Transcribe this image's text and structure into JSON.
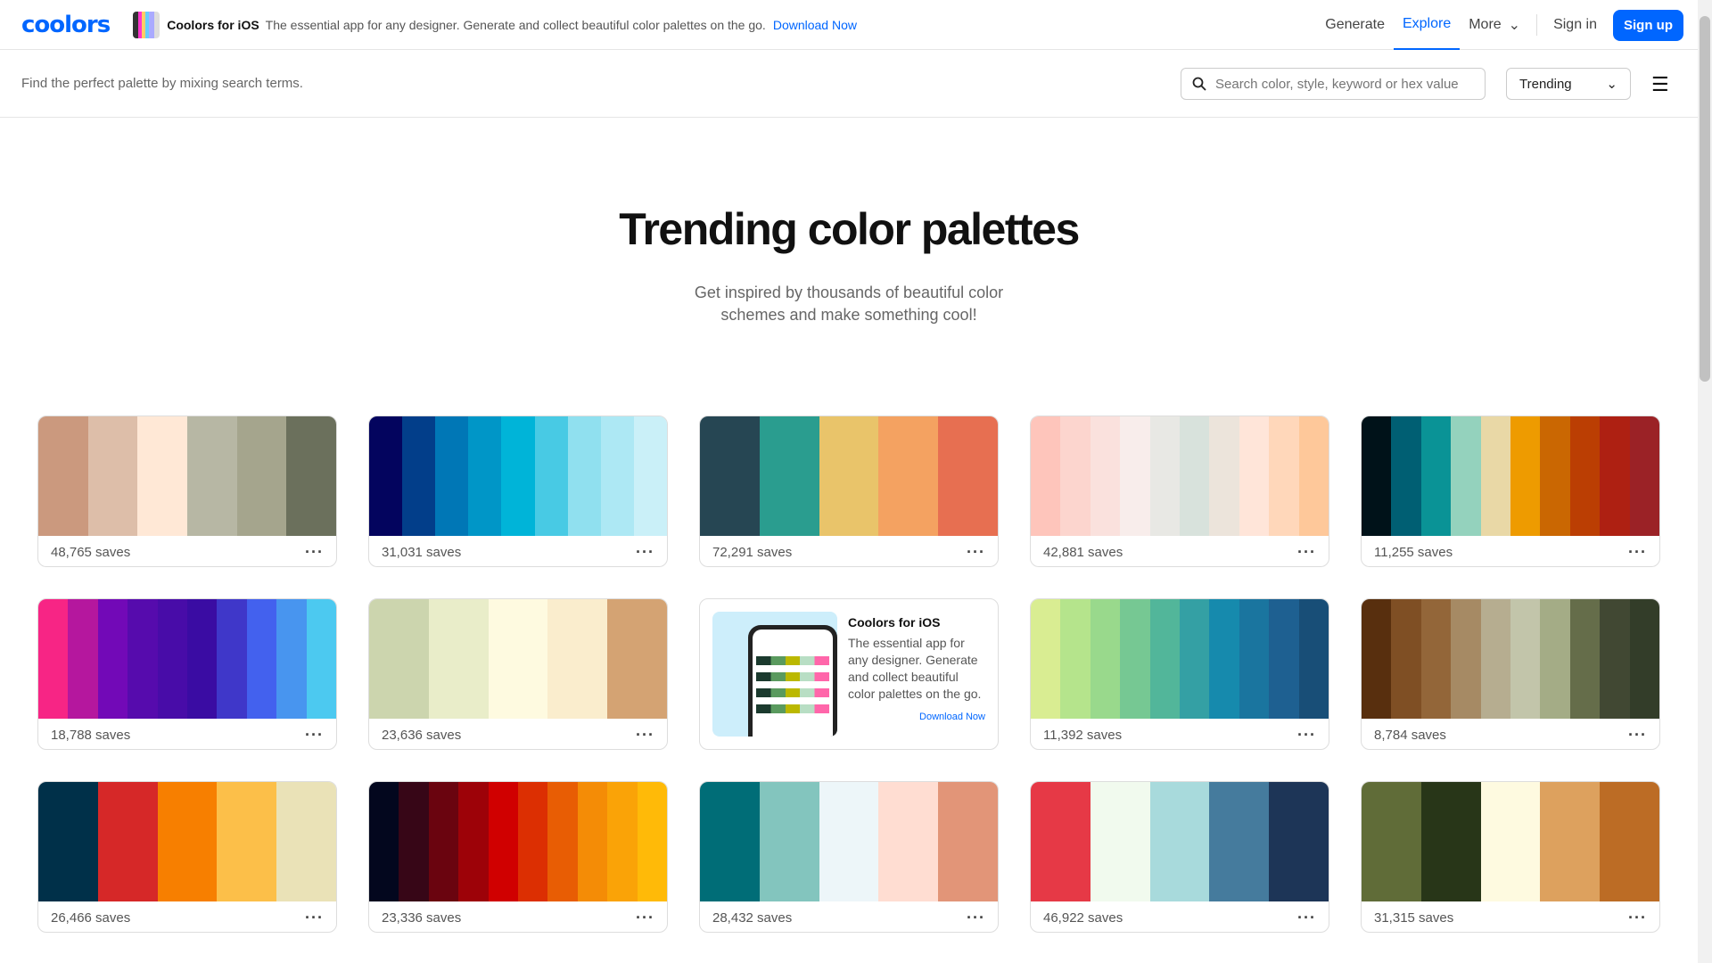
{
  "header": {
    "logo": "coolors",
    "promo_title": "Coolors for iOS",
    "promo_text": "The essential app for any designer. Generate and collect beautiful color palettes on the go.",
    "promo_link": "Download Now",
    "nav": [
      "Generate",
      "Explore",
      "More"
    ],
    "sign_in": "Sign in",
    "sign_up": "Sign up"
  },
  "subbar": {
    "hint": "Find the perfect palette by mixing search terms.",
    "search_placeholder": "Search color, style, keyword or hex value",
    "sort": "Trending"
  },
  "title": "Trending color palettes",
  "subtitle": "Get inspired by thousands of beautiful color schemes and make something cool!",
  "ad": {
    "title": "Coolors for iOS",
    "text": "The essential app for any designer. Generate and collect beautiful color palettes on the go.",
    "link": "Download Now"
  },
  "palettes": [
    {
      "saves": "48,765 saves",
      "colors": [
        "#cb997e",
        "#ddbea9",
        "#ffe8d6",
        "#b7b7a4",
        "#a5a58d",
        "#6b705c"
      ]
    },
    {
      "saves": "31,031 saves",
      "colors": [
        "#03045e",
        "#023e8a",
        "#0077b6",
        "#0096c7",
        "#00b4d8",
        "#48cae4",
        "#90e0ef",
        "#ade8f4",
        "#caf0f8"
      ]
    },
    {
      "saves": "72,291 saves",
      "colors": [
        "#264653",
        "#2a9d8f",
        "#e9c46a",
        "#f4a261",
        "#e76f51"
      ]
    },
    {
      "saves": "42,881 saves",
      "colors": [
        "#fec5bb",
        "#fcd5ce",
        "#fae1dd",
        "#f8edeb",
        "#e8e8e4",
        "#d8e2dc",
        "#ece4db",
        "#ffe5d9",
        "#ffd7ba",
        "#fec89a"
      ]
    },
    {
      "saves": "11,255 saves",
      "colors": [
        "#001219",
        "#005f73",
        "#0a9396",
        "#94d2bd",
        "#e9d8a6",
        "#ee9b00",
        "#ca6702",
        "#bb3e03",
        "#ae2012",
        "#9b2226"
      ]
    },
    {
      "saves": "18,788 saves",
      "colors": [
        "#f72585",
        "#b5179e",
        "#7209b7",
        "#560bad",
        "#480ca8",
        "#3a0ca3",
        "#3f37c9",
        "#4361ee",
        "#4895ef",
        "#4cc9f0"
      ]
    },
    {
      "saves": "23,636 saves",
      "colors": [
        "#ccd5ae",
        "#e9edc9",
        "#fefae0",
        "#faedcd",
        "#d4a373"
      ]
    },
    null,
    {
      "saves": "11,392 saves",
      "colors": [
        "#d9ed92",
        "#b5e48c",
        "#99d98c",
        "#76c893",
        "#52b69a",
        "#34a0a4",
        "#168aad",
        "#1a759f",
        "#1e6091",
        "#184e77"
      ]
    },
    {
      "saves": "8,784 saves",
      "colors": [
        "#582f0e",
        "#7f4f24",
        "#936639",
        "#a68a64",
        "#b6ad90",
        "#c2c5aa",
        "#a4ac86",
        "#656d4a",
        "#414833",
        "#333d29"
      ]
    },
    {
      "saves": "26,466 saves",
      "colors": [
        "#003049",
        "#d62828",
        "#f77f00",
        "#fcbf49",
        "#eae2b7"
      ]
    },
    {
      "saves": "23,336 saves",
      "colors": [
        "#03071e",
        "#370617",
        "#6a040f",
        "#9d0208",
        "#d00000",
        "#dc2f02",
        "#e85d04",
        "#f48c06",
        "#faa307",
        "#ffba08"
      ]
    },
    {
      "saves": "28,432 saves",
      "colors": [
        "#006d77",
        "#83c5be",
        "#edf6f9",
        "#ffddd2",
        "#e29578"
      ]
    },
    {
      "saves": "46,922 saves",
      "colors": [
        "#e63946",
        "#f1faee",
        "#a8dadc",
        "#457b9d",
        "#1d3557"
      ]
    },
    {
      "saves": "31,315 saves",
      "colors": [
        "#606c38",
        "#283618",
        "#fefae0",
        "#dda15e",
        "#bc6c25"
      ]
    }
  ]
}
